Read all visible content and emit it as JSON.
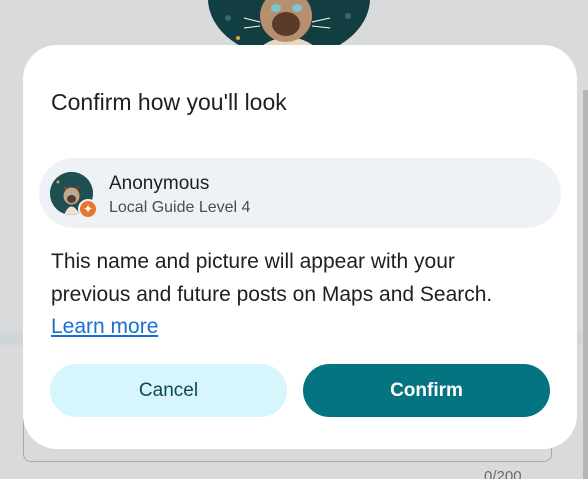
{
  "dialog": {
    "title": "Confirm how you'll look",
    "identity": {
      "name": "Anonymous",
      "level": "Local Guide Level 4",
      "badge_icon": "local-guide-star-icon",
      "avatar_icon": "siamese-cat-avatar"
    },
    "body_text": "This name and picture will appear with your previous and future posts on Maps and Search.",
    "learn_more_label": "Learn more",
    "cancel_label": "Cancel",
    "confirm_label": "Confirm"
  },
  "background": {
    "counter_text": "0/200"
  },
  "colors": {
    "primary": "#047480",
    "primary_container": "#d7f5fc",
    "link": "#1a6fd1",
    "badge": "#e9752c",
    "card": "#eef2f6"
  }
}
